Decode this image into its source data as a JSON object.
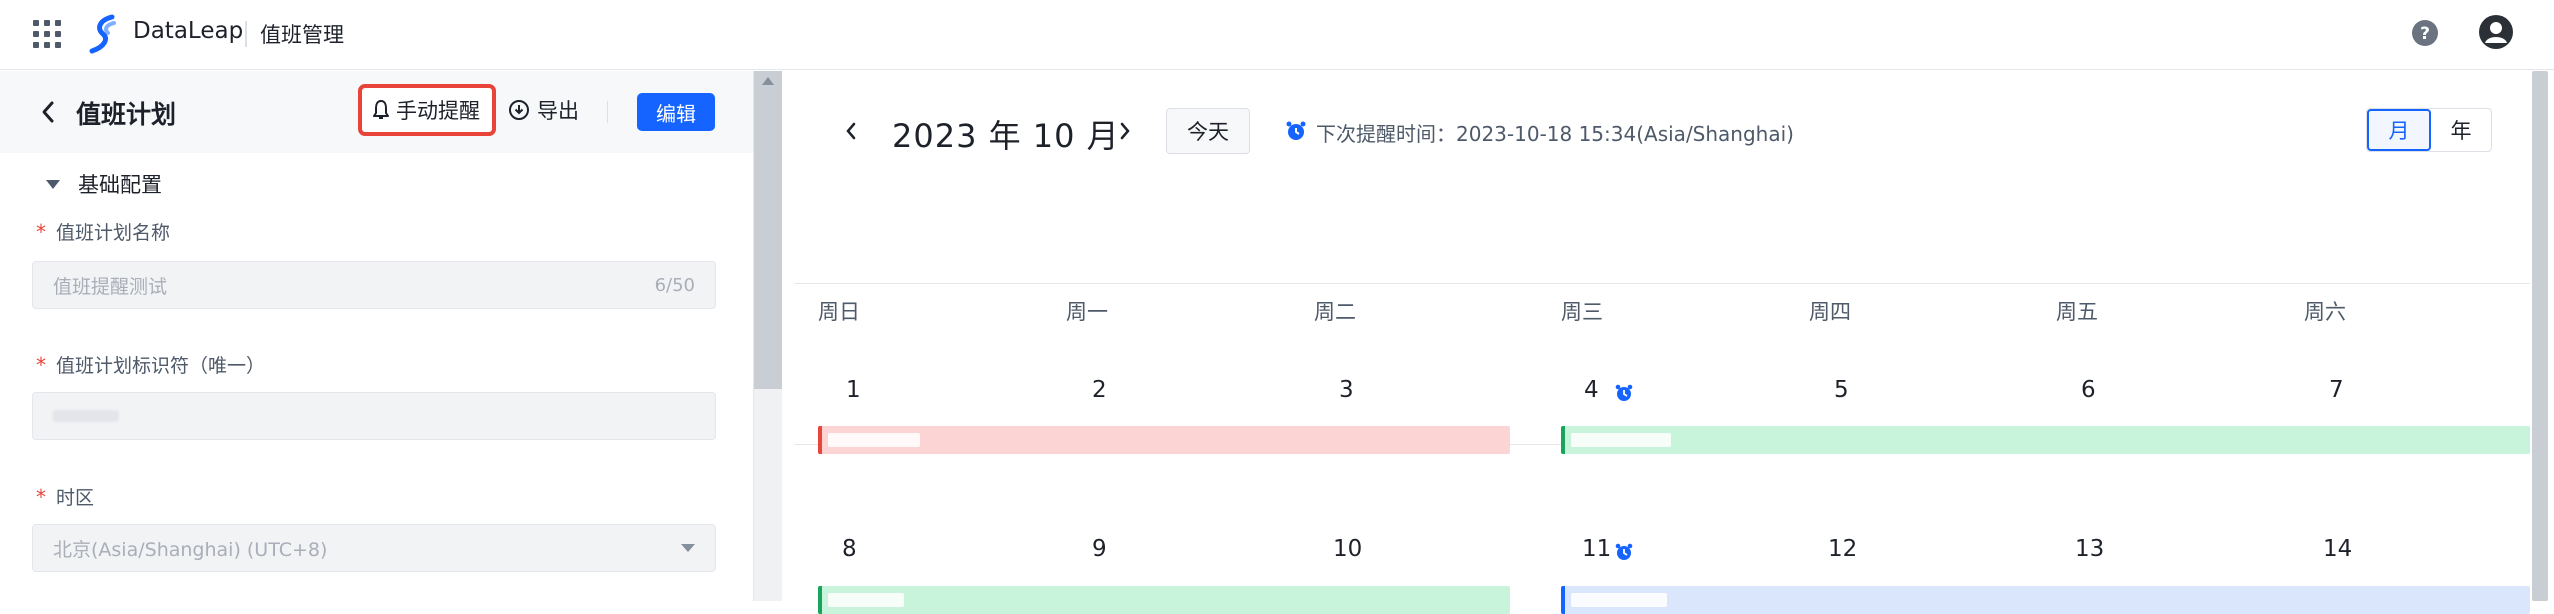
{
  "topbar": {
    "brand": "DataLeap",
    "module": "值班管理"
  },
  "plan": {
    "title": "值班计划",
    "remind_label": "手动提醒",
    "export_label": "导出",
    "edit_label": "编辑"
  },
  "config": {
    "section_title": "基础配置",
    "required_mark": "*",
    "name_label": "值班计划名称",
    "name_value": "值班提醒测试",
    "name_count": "6/50",
    "identifier_label": "值班计划标识符（唯一）",
    "timezone_label": "时区",
    "timezone_value": "北京(Asia/Shanghai) (UTC+8)"
  },
  "calendar": {
    "month_title": "2023 年 10 月",
    "today_label": "今天",
    "next_remind": "下次提醒时间：2023-10-18 15:34(Asia/Shanghai)",
    "view_month": "月",
    "view_year": "年",
    "weekdays": [
      "周日",
      "周一",
      "周二",
      "周三",
      "周四",
      "周五",
      "周六"
    ],
    "week1": [
      "1",
      "2",
      "3",
      "4",
      "5",
      "6",
      "7"
    ],
    "week2": [
      "8",
      "9",
      "10",
      "11",
      "12",
      "13",
      "14"
    ],
    "colors": {
      "red": "#fdd4d4",
      "red_edge": "#e8443a",
      "green": "#c8f4dc",
      "green_edge": "#1aa35c",
      "blue": "#dae6fc",
      "blue_edge": "#1664ff"
    }
  }
}
